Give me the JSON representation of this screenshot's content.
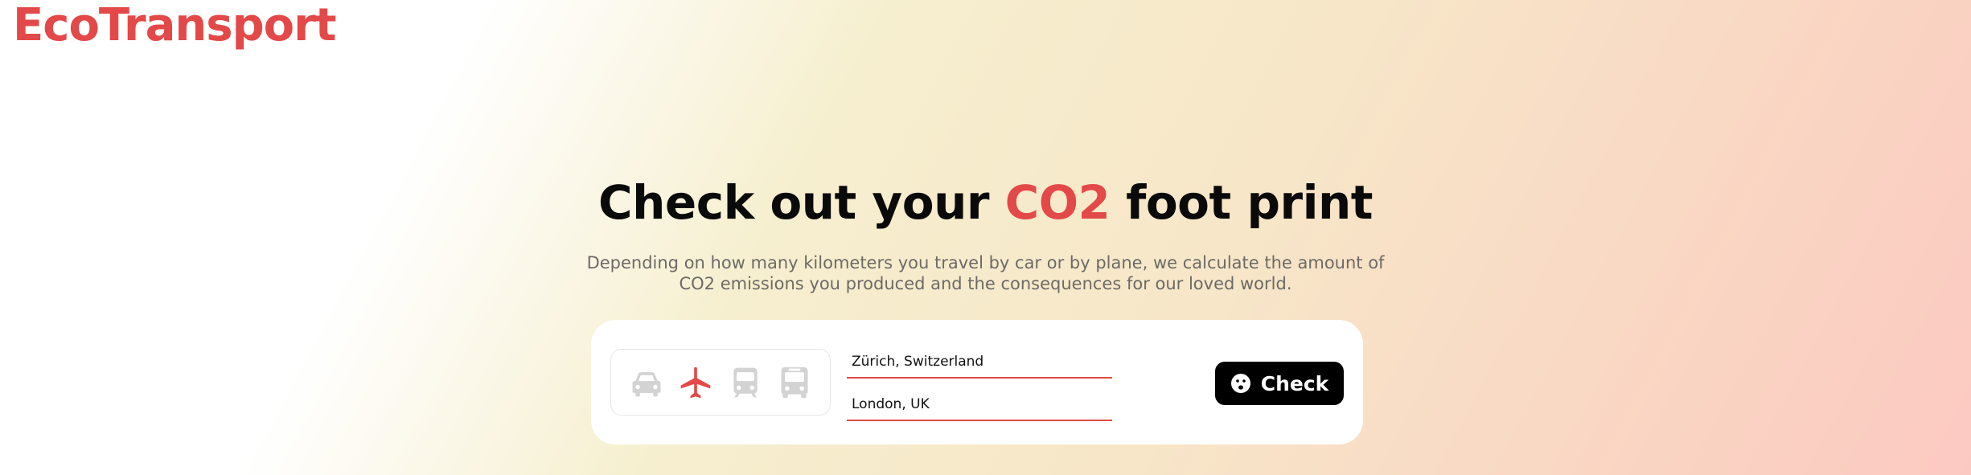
{
  "brand": {
    "name": "EcoTransport",
    "color": "#e34948"
  },
  "hero": {
    "title_before": "Check out your ",
    "title_accent": "CO2",
    "title_after": " foot print",
    "subtitle_line1": "Depending on how many kilometers you travel by car or by plane, we calculate the amount of",
    "subtitle_line2": "CO2 emissions you produced and the consequences for our loved world."
  },
  "form": {
    "transport_modes": [
      {
        "icon": "car-icon",
        "selected": false
      },
      {
        "icon": "airplane-icon",
        "selected": true
      },
      {
        "icon": "train-icon",
        "selected": false
      },
      {
        "icon": "bus-icon",
        "selected": false
      }
    ],
    "from_value": "Zürich, Switzerland",
    "to_value": "London, UK",
    "check_label": "Check",
    "check_icon": "sad-face-icon"
  },
  "colors": {
    "accent": "#e34948",
    "inactive_icon": "#d3d3d3",
    "button_bg": "#000000"
  }
}
